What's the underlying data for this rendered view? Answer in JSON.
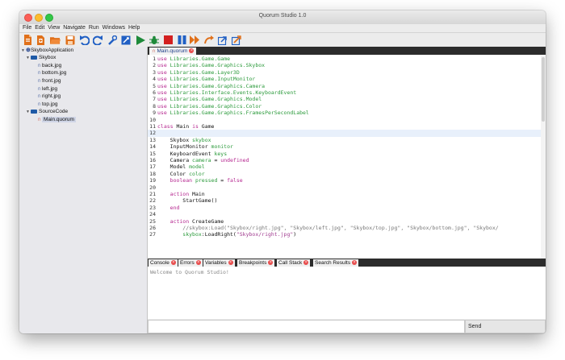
{
  "window": {
    "title": "Quorum Studio 1.0"
  },
  "menu": [
    "File",
    "Edit",
    "View",
    "Navigate",
    "Run",
    "Windows",
    "Help"
  ],
  "toolbar": {
    "icons": [
      "new-file-icon",
      "new-project-icon",
      "open-folder-icon",
      "save-icon",
      "undo-icon",
      "redo-icon",
      "wrench-icon",
      "build-icon",
      "run-icon",
      "debug-bug-icon",
      "stop-icon",
      "pause-icon",
      "step-over-icon",
      "step-into-icon",
      "step-out-icon",
      "deploy-icon"
    ],
    "colors": {
      "run": "#1e8a3a",
      "stop": "#d32020",
      "blue": "#2160c4",
      "orange": "#e0701a"
    }
  },
  "sidebar": {
    "tree": [
      {
        "label": "SkyboxApplication",
        "level": 0,
        "type": "project",
        "expanded": true
      },
      {
        "label": "Skybox",
        "level": 1,
        "type": "folder",
        "expanded": true
      },
      {
        "label": "back.jpg",
        "level": 2,
        "type": "file"
      },
      {
        "label": "bottom.jpg",
        "level": 2,
        "type": "file"
      },
      {
        "label": "front.jpg",
        "level": 2,
        "type": "file"
      },
      {
        "label": "left.jpg",
        "level": 2,
        "type": "file"
      },
      {
        "label": "right.jpg",
        "level": 2,
        "type": "file"
      },
      {
        "label": "top.jpg",
        "level": 2,
        "type": "file"
      },
      {
        "label": "SourceCode",
        "level": 1,
        "type": "folder",
        "expanded": true
      },
      {
        "label": "Main.quorum",
        "level": 2,
        "type": "source",
        "selected": true
      }
    ]
  },
  "editor": {
    "tab": "Main.quorum",
    "highlight_line": 12,
    "lines": [
      {
        "n": "1",
        "t": [
          [
            "kw",
            "use"
          ],
          [
            "id",
            " Libraries.Game.Game"
          ]
        ]
      },
      {
        "n": "2",
        "t": [
          [
            "kw",
            "use"
          ],
          [
            "id",
            " Libraries.Game.Graphics.Skybox"
          ]
        ]
      },
      {
        "n": "3",
        "t": [
          [
            "kw",
            "use"
          ],
          [
            "id",
            " Libraries.Game.Layer3D"
          ]
        ]
      },
      {
        "n": "4",
        "t": [
          [
            "kw",
            "use"
          ],
          [
            "id",
            " Libraries.Game.InputMonitor"
          ]
        ]
      },
      {
        "n": "5",
        "t": [
          [
            "kw",
            "use"
          ],
          [
            "id",
            " Libraries.Game.Graphics.Camera"
          ]
        ]
      },
      {
        "n": "6",
        "t": [
          [
            "kw",
            "use"
          ],
          [
            "id",
            " Libraries.Interface.Events.KeyboardEvent"
          ]
        ]
      },
      {
        "n": "7",
        "t": [
          [
            "kw",
            "use"
          ],
          [
            "id",
            " Libraries.Game.Graphics.Model"
          ]
        ]
      },
      {
        "n": "8",
        "t": [
          [
            "kw",
            "use"
          ],
          [
            "id",
            " Libraries.Game.Graphics.Color"
          ]
        ]
      },
      {
        "n": "9",
        "t": [
          [
            "kw",
            "use"
          ],
          [
            "id",
            " Libraries.Game.Graphics.FramesPerSecondLabel"
          ]
        ]
      },
      {
        "n": "10",
        "t": []
      },
      {
        "n": "11",
        "t": [
          [
            "kw",
            "class"
          ],
          [
            "txt-b",
            " Main "
          ],
          [
            "kw",
            "is"
          ],
          [
            "txt-b",
            " Game"
          ]
        ]
      },
      {
        "n": "12",
        "t": []
      },
      {
        "n": "13",
        "t": [
          [
            "txt-b",
            "    Skybox "
          ],
          [
            "id",
            "skybox"
          ]
        ]
      },
      {
        "n": "14",
        "t": [
          [
            "txt-b",
            "    InputMonitor "
          ],
          [
            "id",
            "monitor"
          ]
        ]
      },
      {
        "n": "15",
        "t": [
          [
            "txt-b",
            "    KeyboardEvent "
          ],
          [
            "id",
            "keys"
          ]
        ]
      },
      {
        "n": "16",
        "t": [
          [
            "txt-b",
            "    Camera "
          ],
          [
            "id",
            "camera"
          ],
          [
            "txt-b",
            " = "
          ],
          [
            "kw",
            "undefined"
          ]
        ]
      },
      {
        "n": "17",
        "t": [
          [
            "txt-b",
            "    Model "
          ],
          [
            "id",
            "model"
          ]
        ]
      },
      {
        "n": "18",
        "t": [
          [
            "txt-b",
            "    Color "
          ],
          [
            "id",
            "color"
          ]
        ]
      },
      {
        "n": "19",
        "t": [
          [
            "kw",
            "    boolean"
          ],
          [
            "txt-b",
            " "
          ],
          [
            "id",
            "pressed"
          ],
          [
            "txt-b",
            " = "
          ],
          [
            "kw",
            "false"
          ]
        ]
      },
      {
        "n": "20",
        "t": []
      },
      {
        "n": "21",
        "t": [
          [
            "kw",
            "    action"
          ],
          [
            "txt-b",
            " Main"
          ]
        ]
      },
      {
        "n": "22",
        "t": [
          [
            "txt-b",
            "        StartGame()"
          ]
        ]
      },
      {
        "n": "23",
        "t": [
          [
            "kw",
            "    end"
          ]
        ]
      },
      {
        "n": "24",
        "t": []
      },
      {
        "n": "25",
        "t": [
          [
            "kw",
            "    action"
          ],
          [
            "txt-b",
            " CreateGame"
          ]
        ]
      },
      {
        "n": "26",
        "t": [
          [
            "cm",
            "        //skybox:Load(\"Skybox/right.jpg\", \"Skybox/left.jpg\", \"Skybox/top.jpg\", \"Skybox/bottom.jpg\", \"Skybox/"
          ]
        ]
      },
      {
        "n": "27",
        "t": [
          [
            "id",
            "        skybox"
          ],
          [
            "txt-b",
            ":LoadRight("
          ],
          [
            "str",
            "\"Skybox/right.jpg\""
          ],
          [
            "txt-b",
            ")"
          ]
        ]
      }
    ]
  },
  "bottom_tabs": [
    "Console",
    "Errors",
    "Variables",
    "Breakpoints",
    "Call Stack",
    "Search Results"
  ],
  "console": {
    "welcome": "Welcome to Quorum Studio!"
  },
  "input": {
    "value": "",
    "send_label": "Send"
  }
}
